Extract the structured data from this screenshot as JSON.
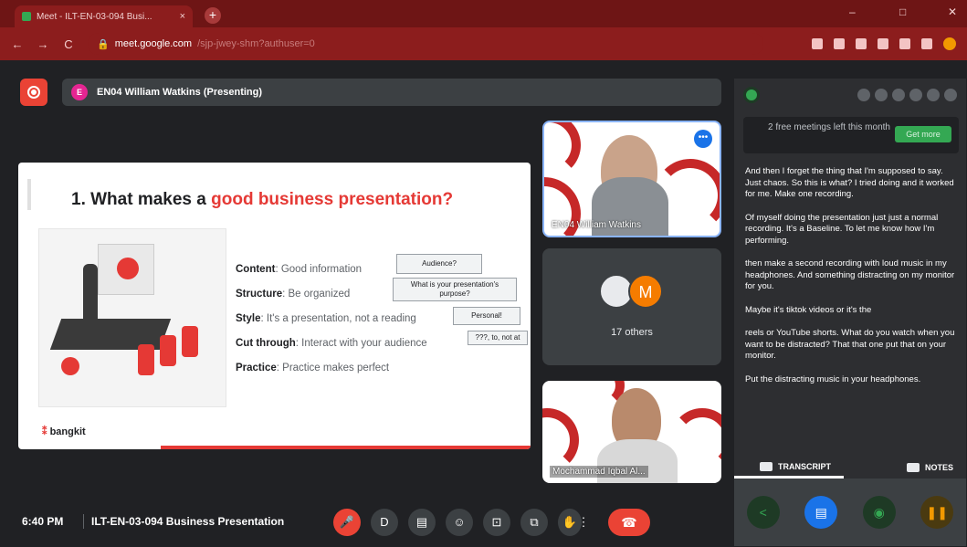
{
  "browser": {
    "tab_title": "Meet - ILT-EN-03-094 Busi...",
    "tab_close": "×",
    "new_tab": "+",
    "url_host": "meet.google.com",
    "url_path": "/sjp-jwey-shm?authuser=0",
    "nav": {
      "back": "←",
      "forward": "→",
      "reload": "C"
    },
    "window": {
      "minimize": "–",
      "restore": "□",
      "close": "✕"
    }
  },
  "meet": {
    "presenter_initial": "E",
    "presenter_label": "EN04 William Watkins (Presenting)",
    "others_count": "17 others",
    "other_avatar_initial": "M",
    "tile1_name": "EN04 William Watkins",
    "tile3_name": "Mochammad Iqbal Al...",
    "tile_more": "•••",
    "clock": "6:40 PM",
    "meeting_name": "ILT-EN-03-094 Business Presentation"
  },
  "slide": {
    "title_prefix": "1.  What makes a ",
    "title_highlight": "good business presentation?",
    "bullets": [
      {
        "label": "Content",
        "text": ": Good information"
      },
      {
        "label": "Structure",
        "text": ": Be organized"
      },
      {
        "label": "Style",
        "text": ": It's a presentation, not a reading"
      },
      {
        "label": "Cut through",
        "text": ": Interact with your audience"
      },
      {
        "label": "Practice",
        "text": ": Practice makes perfect"
      }
    ],
    "notes": [
      "Audience?",
      "What is your presentation's purpose?",
      "Personal!",
      "???, to, not at"
    ],
    "logo": "bangkit"
  },
  "controls": {
    "mic": "🎤",
    "cc": "D",
    "captions": "▤",
    "emoji": "☺",
    "present": "⊡",
    "activities": "⧉",
    "hand": "✋",
    "more": "⋮",
    "end": "☎"
  },
  "panel": {
    "promo_text": "2 free meetings left this month",
    "promo_button": "Get more",
    "transcript": [
      "And then I forget the thing that I'm supposed to say. Just chaos. So this is what? I tried doing and it worked for me. Make one recording.",
      "Of myself doing the presentation just just a normal recording. It's a Baseline. To let me know how I'm performing.",
      "then make a second recording with loud music in my headphones. And something distracting on my monitor for you.",
      "Maybe it's tiktok videos or it's the",
      "reels or YouTube shorts. What do you watch when you want to be distracted? That that one put that on your monitor.",
      "Put the distracting music in your headphones."
    ],
    "tab_transcript": "TRANSCRIPT",
    "tab_notes": "NOTES"
  },
  "colors": {
    "accent_red": "#ea4335",
    "brand_red": "#e53935",
    "chrome_red": "#8c1d1d",
    "meet_bg": "#202124"
  }
}
